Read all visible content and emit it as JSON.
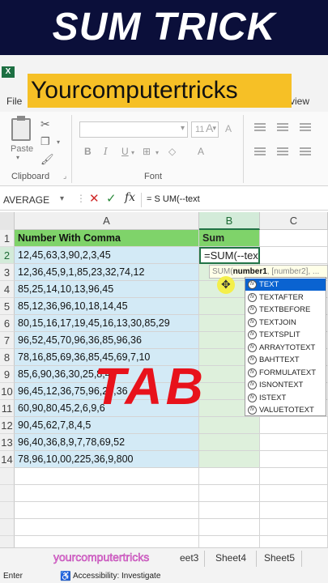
{
  "banner": {
    "title": "SUM TRICK"
  },
  "brand": {
    "label": "Yourcomputertricks"
  },
  "app": {
    "logo": "X"
  },
  "ribbon_tabs": {
    "file": "File",
    "view": "view"
  },
  "clipboard": {
    "paste_label": "Paste",
    "group_label": "Clipboard",
    "icons": [
      "cut-icon",
      "copy-icon",
      "format-painter-icon"
    ]
  },
  "font_group": {
    "size_value": "11",
    "bold": "B",
    "italic": "I",
    "underline": "U",
    "grow": "A",
    "shrink": "A",
    "group_label": "Font"
  },
  "formula_bar": {
    "name_box": "AVERAGE",
    "fx": "fx",
    "formula": "= S UM(--text"
  },
  "columns": [
    "A",
    "B",
    "C"
  ],
  "grid": {
    "row_numbers": [
      "1",
      "2",
      "3",
      "4",
      "5",
      "6",
      "7",
      "8",
      "9",
      "10",
      "11",
      "12",
      "13",
      "14"
    ],
    "header": {
      "a": "Number With Comma",
      "b": "Sum"
    },
    "active_cell_text": "=SUM(--text",
    "values": [
      "12,45,63,3,90,2,3,45",
      "12,36,45,9,1,85,23,32,74,12",
      "85,25,14,10,13,96,45",
      "85,12,36,96,10,18,14,45",
      "80,15,16,17,19,45,16,13,30,85,29",
      "96,52,45,70,96,36,85,96,36",
      "78,16,85,69,36,85,45,69,7,10",
      "85,6,90,36,30,25,8,41",
      "96,45,12,36,75,96,25,36",
      "60,90,80,45,2,6,9,6",
      "90,45,62,7,8,4,5",
      "96,40,36,8,9,7,78,69,52",
      "78,96,10,00,225,36,9,800"
    ]
  },
  "autocomplete": {
    "tooltip_fn": "SUM(",
    "tooltip_bold": "number1",
    "tooltip_rest": ", [number2], ...",
    "items": [
      "TEXT",
      "TEXTAFTER",
      "TEXTBEFORE",
      "TEXTJOIN",
      "TEXTSPLIT",
      "ARRAYTOTEXT",
      "BAHTTEXT",
      "FORMULATEXT",
      "ISNONTEXT",
      "ISTEXT",
      "VALUETOTEXT"
    ],
    "selected_index": 0,
    "item_icon": "fx"
  },
  "overlay": {
    "text": "TAB"
  },
  "sheets": {
    "tab3": "eet3",
    "tab4": "Sheet4",
    "tab5": "Sheet5"
  },
  "watermark": "yourcomputertricks",
  "status": {
    "mode": "Enter",
    "accessibility": "Accessibility: Investigate"
  },
  "colors": {
    "header_green": "#7fd36a",
    "column_a_fill": "#d3eaf6",
    "column_b_fill": "#def0dc",
    "overlay_red": "#e8121b",
    "brand_yellow": "#f6c026",
    "banner_navy": "#0b0f3a"
  }
}
